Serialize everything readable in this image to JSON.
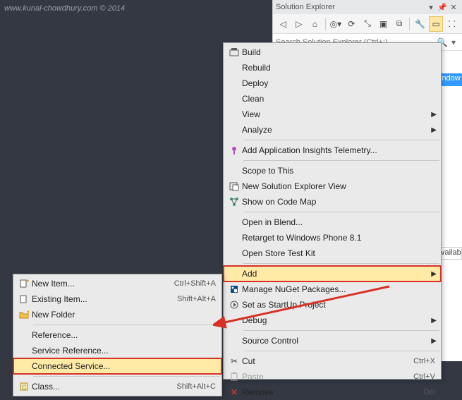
{
  "watermark": "www.kunal-chowdhury.com © 2014",
  "solutionExplorer": {
    "title": "Solution Explorer",
    "search_placeholder": "Search Solution Explorer (Ctrl+;)",
    "band1": "indow",
    "band2": "vailab"
  },
  "mainMenu": {
    "items": [
      {
        "icon": "build",
        "label": "Build"
      },
      {
        "icon": "",
        "label": "Rebuild"
      },
      {
        "icon": "",
        "label": "Deploy"
      },
      {
        "icon": "",
        "label": "Clean"
      },
      {
        "icon": "",
        "label": "View",
        "sub": true
      },
      {
        "icon": "",
        "label": "Analyze",
        "sub": true
      },
      {
        "sep": true
      },
      {
        "icon": "insights",
        "label": "Add Application Insights Telemetry..."
      },
      {
        "sep": true
      },
      {
        "icon": "",
        "label": "Scope to This"
      },
      {
        "icon": "newse",
        "label": "New Solution Explorer View"
      },
      {
        "icon": "codemap",
        "label": "Show on Code Map"
      },
      {
        "sep": true
      },
      {
        "icon": "",
        "label": "Open in Blend..."
      },
      {
        "icon": "",
        "label": "Retarget to Windows Phone 8.1"
      },
      {
        "icon": "",
        "label": "Open Store Test Kit"
      },
      {
        "sep": true
      },
      {
        "icon": "",
        "label": "Add",
        "sub": true,
        "highlight": true,
        "red": true
      },
      {
        "icon": "nuget",
        "label": "Manage NuGet Packages..."
      },
      {
        "icon": "startup",
        "label": "Set as StartUp Project"
      },
      {
        "icon": "",
        "label": "Debug",
        "sub": true
      },
      {
        "sep": true
      },
      {
        "icon": "",
        "label": "Source Control",
        "sub": true
      },
      {
        "sep": true
      },
      {
        "icon": "cut",
        "label": "Cut",
        "short": "Ctrl+X"
      },
      {
        "icon": "paste",
        "label": "Paste",
        "short": "Ctrl+V",
        "disabled": true
      },
      {
        "icon": "remove",
        "label": "Remove",
        "short": "Del"
      }
    ]
  },
  "subMenu": {
    "items": [
      {
        "icon": "newitem",
        "label": "New Item...",
        "short": "Ctrl+Shift+A"
      },
      {
        "icon": "existing",
        "label": "Existing Item...",
        "short": "Shift+Alt+A"
      },
      {
        "icon": "folder",
        "label": "New Folder"
      },
      {
        "sep": true
      },
      {
        "icon": "",
        "label": "Reference..."
      },
      {
        "icon": "",
        "label": "Service Reference..."
      },
      {
        "icon": "",
        "label": "Connected Service...",
        "highlight": true,
        "red": true
      },
      {
        "sep": true
      },
      {
        "icon": "class",
        "label": "Class...",
        "short": "Shift+Alt+C"
      }
    ]
  }
}
